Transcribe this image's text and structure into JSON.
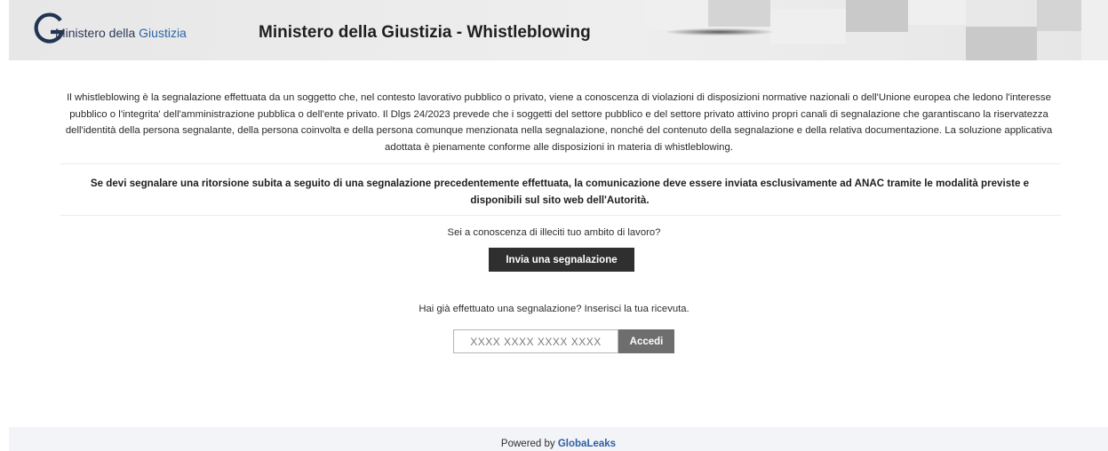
{
  "header": {
    "logo_prefix": "Ministero della ",
    "logo_accent": "Giustizia",
    "title": "Ministero della Giustizia - Whistleblowing"
  },
  "main": {
    "intro": "Il whistleblowing è la segnalazione effettuata da un soggetto che, nel contesto lavorativo pubblico o privato, viene a conoscenza di violazioni di disposizioni normative nazionali o dell'Unione europea che ledono l'interesse pubblico o l'integrita' dell'amministrazione pubblica o dell'ente privato. Il Dlgs 24/2023 prevede che i soggetti del settore pubblico e del settore privato attivino propri canali di segnalazione che garantiscano la riservatezza dell'identità della persona segnalante, della persona coinvolta e della persona comunque menzionata nella segnalazione, nonché del contenuto della segnalazione e della relativa documentazione. La soluzione applicativa adottata è pienamente conforme alle disposizioni in materia di whistleblowing.",
    "notice": "Se devi segnalare una ritorsione subita a seguito di una segnalazione precedentemente effettuata, la comunicazione deve essere inviata esclusivamente ad ANAC tramite le modalità previste e disponibili sul sito web dell'Autorità.",
    "report_question": "Sei a conoscenza di illeciti tuo ambito di lavoro?",
    "report_button": "Invia una segnalazione",
    "receipt_question": "Hai già effettuato una segnalazione? Inserisci la tua ricevuta.",
    "receipt_placeholder": "XXXX XXXX XXXX XXXX",
    "receipt_value": "",
    "access_button": "Accedi"
  },
  "footer": {
    "powered_by": "Powered by ",
    "brand": "GlobaLeaks"
  },
  "colors": {
    "primary_button": "#2f2f2f",
    "secondary_button": "#6e6e6e",
    "link_blue": "#2d5ea3",
    "logo_blue": "#2c64a8",
    "header_bg": "#e9e9e9",
    "footer_bg": "#f3f4f8"
  },
  "icons": {
    "logo": "ministero-g-logo-icon"
  }
}
